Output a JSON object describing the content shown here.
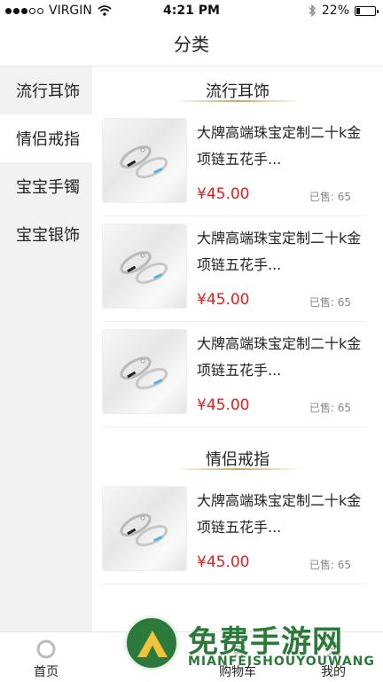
{
  "status_bar": {
    "carrier": "VIRGIN",
    "time": "4:21 PM",
    "battery_text": "22%",
    "battery_level": 0.22,
    "signal_dots_filled": 3,
    "signal_dots_total": 5
  },
  "header": {
    "title": "分类"
  },
  "sidebar": {
    "items": [
      {
        "label": "流行耳饰"
      },
      {
        "label": "情侣戒指"
      },
      {
        "label": "宝宝手镯"
      },
      {
        "label": "宝宝银饰"
      }
    ],
    "active_index": 1
  },
  "sections": [
    {
      "title": "流行耳饰",
      "products": [
        {
          "name": "大牌高端珠宝定制二十k金项链五花手...",
          "price": "¥45.00",
          "sold": "已售: 65"
        },
        {
          "name": "大牌高端珠宝定制二十k金项链五花手...",
          "price": "¥45.00",
          "sold": "已售: 65"
        },
        {
          "name": "大牌高端珠宝定制二十k金项链五花手...",
          "price": "¥45.00",
          "sold": "已售: 65"
        }
      ]
    },
    {
      "title": "情侣戒指",
      "products": [
        {
          "name": "大牌高端珠宝定制二十k金项链五花手...",
          "price": "¥45.00",
          "sold": "已售: 65"
        }
      ]
    }
  ],
  "tabbar": {
    "home": "首页",
    "cart": "购物车",
    "mine": "我的"
  },
  "watermark": {
    "title": "免费手游网",
    "subtitle": "MIANFEISHOUYOUWANG"
  },
  "colors": {
    "price": "#e02020",
    "sidebar_bg": "#f2f2f2",
    "watermark_green": "#2c7a3a"
  }
}
